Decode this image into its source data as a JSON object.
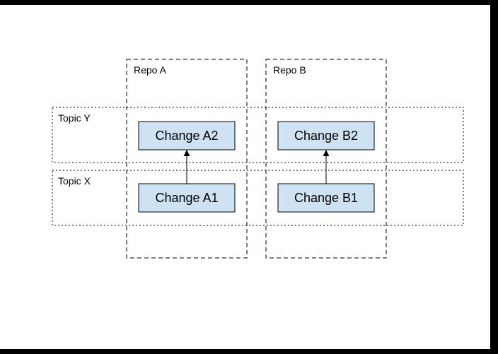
{
  "repos": {
    "a": {
      "label": "Repo A"
    },
    "b": {
      "label": "Repo B"
    }
  },
  "topics": {
    "y": {
      "label": "Topic Y"
    },
    "x": {
      "label": "Topic X"
    }
  },
  "changes": {
    "a1": {
      "label": "Change A1"
    },
    "a2": {
      "label": "Change A2"
    },
    "b1": {
      "label": "Change B1"
    },
    "b2": {
      "label": "Change B2"
    }
  }
}
